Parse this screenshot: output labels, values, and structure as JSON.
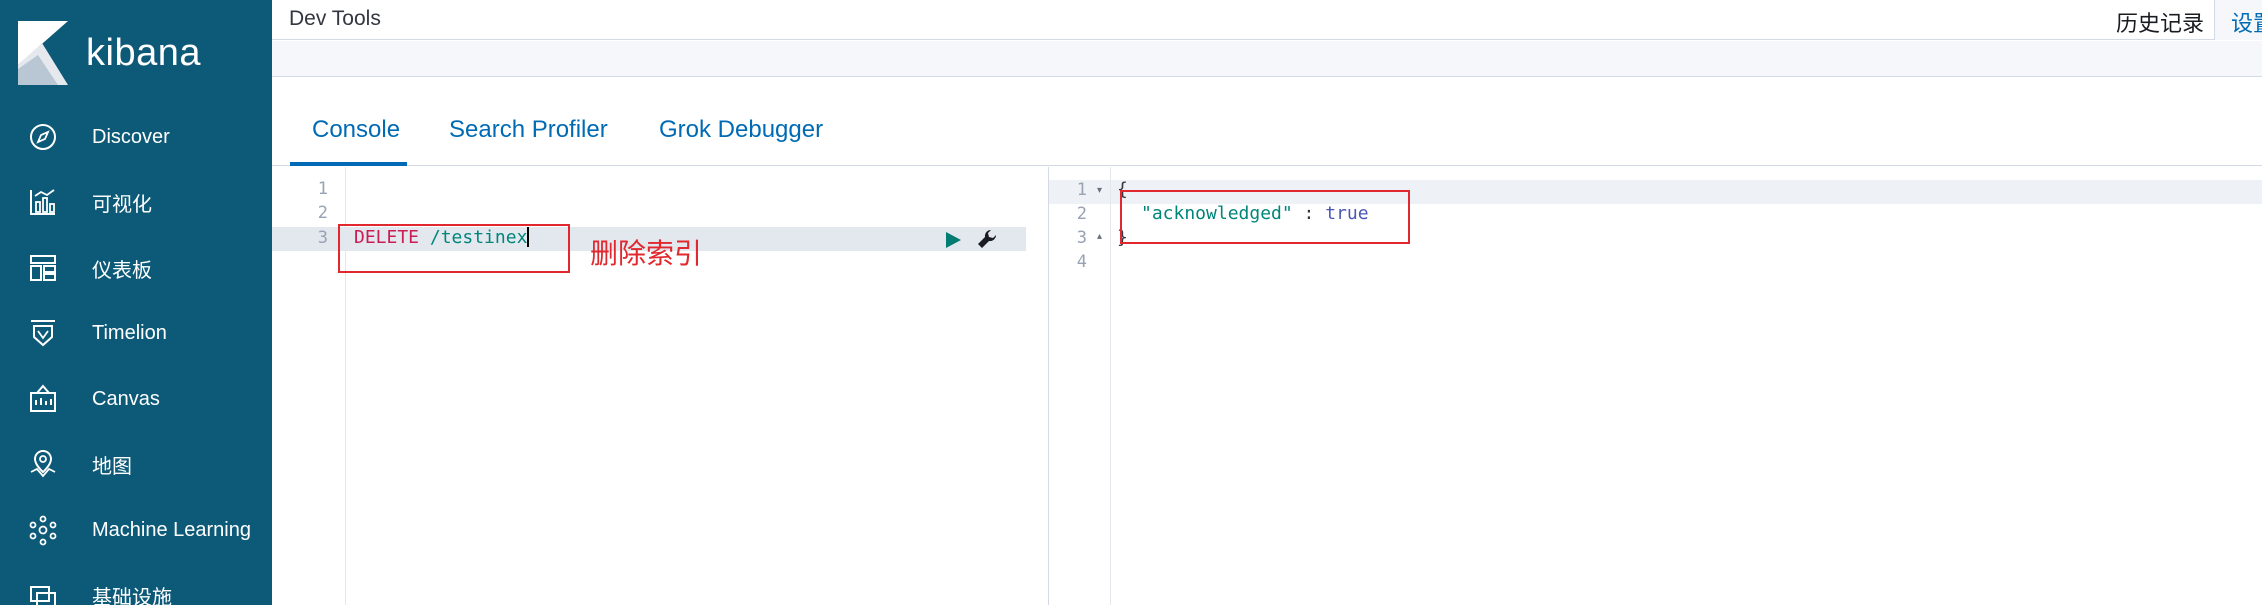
{
  "app": {
    "brand": "kibana"
  },
  "sidebar": {
    "items": [
      {
        "label": "Discover",
        "icon": "compass-icon"
      },
      {
        "label": "可视化",
        "icon": "visualize-icon"
      },
      {
        "label": "仪表板",
        "icon": "dashboard-icon"
      },
      {
        "label": "Timelion",
        "icon": "timelion-icon"
      },
      {
        "label": "Canvas",
        "icon": "canvas-icon"
      },
      {
        "label": "地图",
        "icon": "map-pin-icon"
      },
      {
        "label": "Machine Learning",
        "icon": "machine-learning-icon"
      },
      {
        "label": "基础设施",
        "icon": "infrastructure-icon"
      }
    ]
  },
  "header": {
    "title": "Dev Tools",
    "history_label": "历史记录",
    "settings_label": "设置"
  },
  "tabs": [
    {
      "label": "Console",
      "active": true
    },
    {
      "label": "Search Profiler",
      "active": false
    },
    {
      "label": "Grok Debugger",
      "active": false
    }
  ],
  "request_editor": {
    "line_numbers": [
      "1",
      "2",
      "3"
    ],
    "method": "DELETE",
    "path": "/testinex",
    "run_icon": "play-icon",
    "settings_icon": "wrench-icon"
  },
  "response_editor": {
    "line_numbers": [
      "1",
      "2",
      "3",
      "4"
    ],
    "open_brace": "{",
    "key": "\"acknowledged\"",
    "separator": " : ",
    "value": "true",
    "close_brace": "}"
  },
  "annotation": {
    "label": "删除索引"
  },
  "colors": {
    "sidebar_bg": "#0d5a78",
    "accent": "#006bb4",
    "annotation_red": "#e0282e",
    "method_red": "#c91d53",
    "url_teal": "#00857a",
    "run_green": "#017d73"
  }
}
